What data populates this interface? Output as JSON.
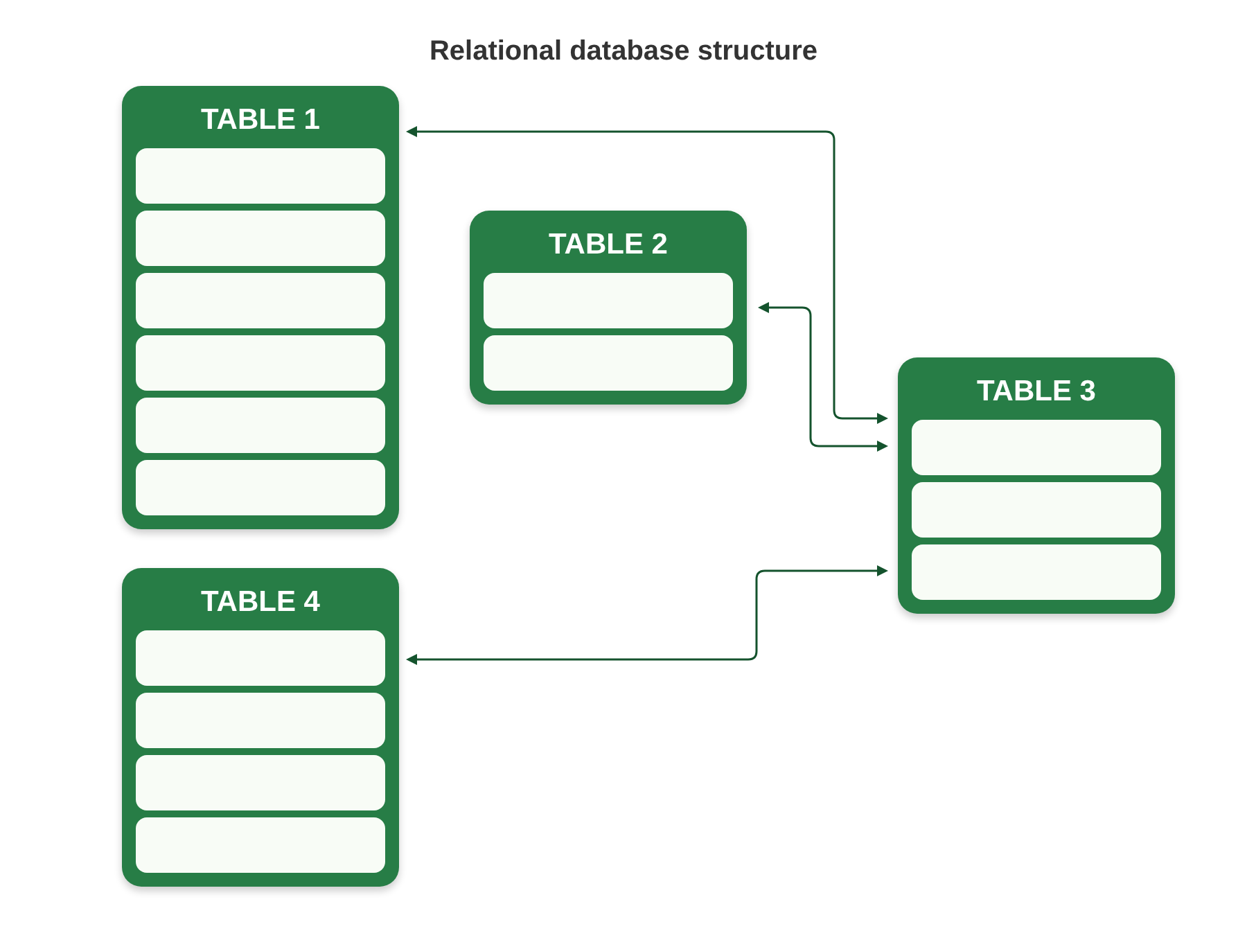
{
  "title": "Relational database structure",
  "tables": [
    {
      "title": "TABLE 1",
      "rows": [
        {
          "kind": "empty"
        },
        {
          "kind": "empty"
        },
        {
          "kind": "empty"
        },
        {
          "kind": "empty"
        },
        {
          "kind": "empty"
        },
        {
          "kind": "empty"
        }
      ]
    },
    {
      "title": "TABLE 2",
      "rows": [
        {
          "kind": "empty"
        },
        {
          "kind": "empty"
        }
      ]
    },
    {
      "title": "TABLE 3",
      "rows": [
        {
          "kind": "empty"
        },
        {
          "kind": "empty"
        },
        {
          "kind": "empty"
        }
      ]
    },
    {
      "title": "TABLE 4",
      "rows": [
        {
          "kind": "empty"
        },
        {
          "kind": "empty"
        },
        {
          "kind": "empty"
        },
        {
          "kind": "empty"
        }
      ]
    }
  ],
  "connections": [
    {
      "kind": "two-way"
    },
    {
      "kind": "two-way"
    },
    {
      "kind": "two-way"
    }
  ]
}
